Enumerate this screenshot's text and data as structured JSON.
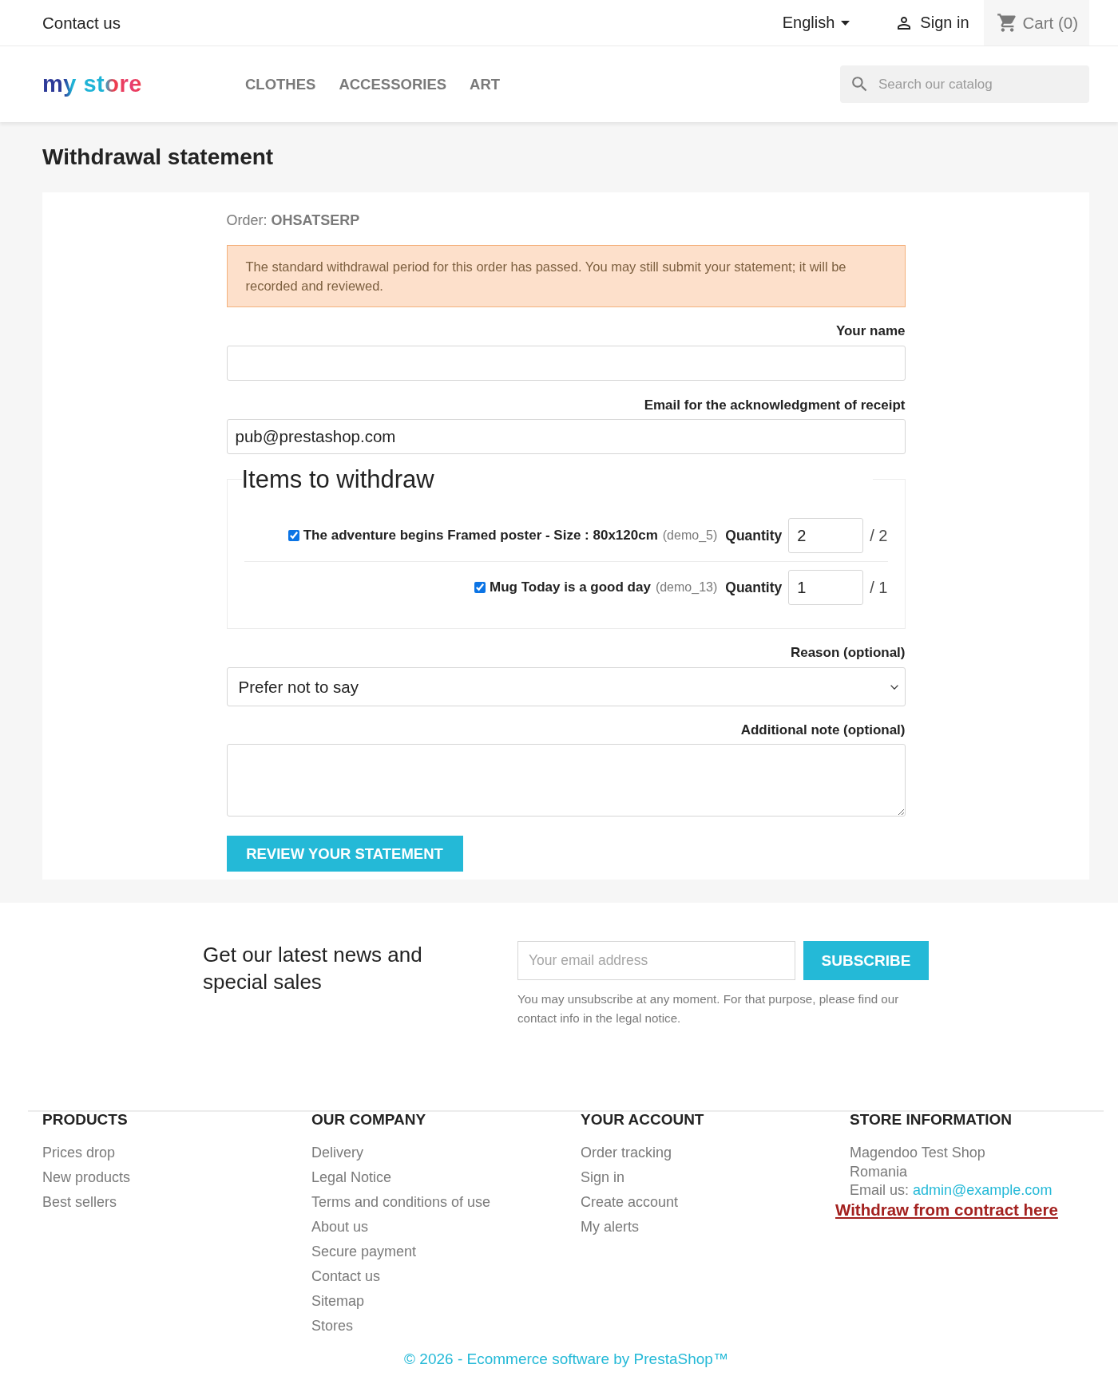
{
  "top_bar": {
    "contact_link": "Contact us",
    "language": "English",
    "sign_in": "Sign in",
    "cart": "Cart (0)"
  },
  "header": {
    "logo": "my store",
    "nav": [
      "CLOTHES",
      "ACCESSORIES",
      "ART"
    ],
    "search": {
      "placeholder": "Search our catalog"
    }
  },
  "page": {
    "title": "Withdrawal statement",
    "order": "Order: **OHSATSERP**",
    "alert": "The standard withdrawal period for this order has passed. You may still submit your statement; it will be recorded and reviewed.",
    "name_field": {
      "label": "Your name"
    },
    "email_field": {
      "label": "Email for the acknowledgment of receipt",
      "value": "pub@prestashop.com"
    },
    "items_to_withdraw": {
      "legend": "Items to withdraw",
      "items": [
        {
          "checked": true,
          "name": "The adventure begins Framed poster - Size : 80x120cm",
          "reference": "(demo_5)",
          "quantity_label": "Quantity",
          "quantity": "2",
          "max": "/ 2"
        },
        {
          "checked": true,
          "name": "Mug Today is a good day",
          "reference": "(demo_13)",
          "quantity_label": "Quantity",
          "quantity": "1",
          "max": "/ 1"
        }
      ]
    },
    "reason_field": {
      "label": "Reason (optional)",
      "value": "Prefer not to say"
    },
    "note_field": {
      "label": "Additional note (optional)"
    },
    "submit_button": "REVIEW YOUR STATEMENT"
  },
  "newsletter": {
    "title": "Get our latest news and special sales",
    "email": {
      "placeholder": "Your email address"
    },
    "button": "SUBSCRIBE",
    "notice": "You may unsubscribe at any moment. For that purpose, please find our contact info in the legal notice."
  },
  "footer": {
    "columns": [
      {
        "title": "PRODUCTS",
        "links": [
          "Prices drop",
          "New products",
          "Best sellers"
        ]
      },
      {
        "title": "OUR COMPANY",
        "links": [
          "Delivery",
          "Legal Notice",
          "Terms and conditions of use",
          "About us",
          "Secure payment",
          "Contact us",
          "Sitemap",
          "Stores"
        ]
      },
      {
        "title": "YOUR ACCOUNT",
        "links": [
          "Order tracking",
          "Sign in",
          "Create account",
          "My alerts"
        ]
      }
    ],
    "store_information": {
      "title": "STORE INFORMATION",
      "lines": [
        "Magendoo Test Shop",
        "Romania"
      ],
      "email_label": "Email us:",
      "email": "admin@example.com",
      "withdraw_link": "Withdraw from contract here"
    },
    "copyright": "© 2026 - Ecommerce software by PrestaShop™"
  }
}
